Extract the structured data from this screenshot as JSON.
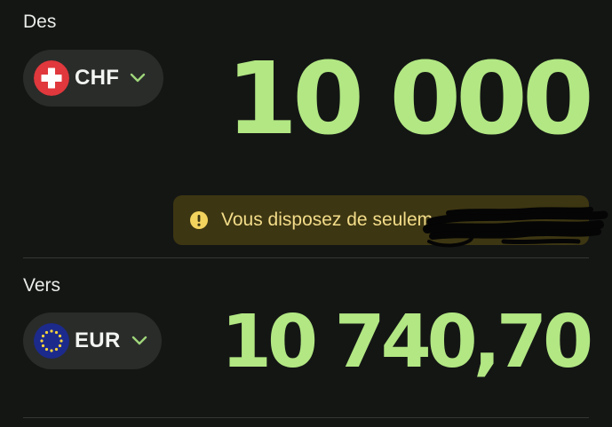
{
  "from": {
    "label": "Des",
    "currency": "CHF",
    "amount": "10 000",
    "flag_icon": "swiss-flag-icon",
    "chevron_icon": "chevron-down-icon"
  },
  "warning": {
    "text": "Vous disposez de seulem",
    "icon": "exclamation-circle-icon",
    "note": "remainder of message covered by a hand-drawn black redaction scribble"
  },
  "to": {
    "label": "Vers",
    "currency": "EUR",
    "amount": "10 740,70",
    "flag_icon": "eu-flag-icon",
    "chevron_icon": "chevron-down-icon"
  },
  "colors": {
    "background": "#141614",
    "pill_bg": "#2a2c2a",
    "amount_green": "#b2e783",
    "chevron_green": "#9fd67a",
    "warning_bg": "#3d3612",
    "warning_text": "#f3dd8a",
    "warning_icon": "#f2d35e",
    "swiss_red": "#e0383c",
    "eu_blue": "#1c2a8c",
    "eu_star": "#f4d33b"
  }
}
